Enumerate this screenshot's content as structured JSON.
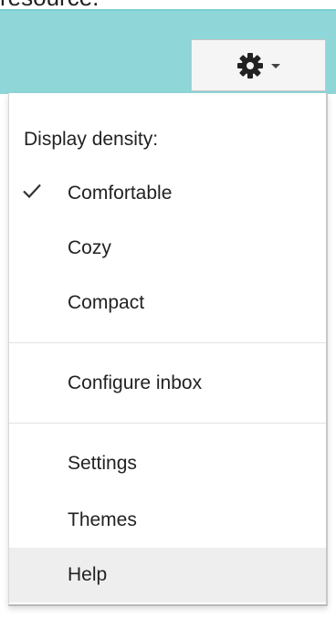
{
  "background_partial_text": "resource.",
  "header": {
    "settings_button": {
      "icon": "gear-icon",
      "dropdown_icon": "caret-down-icon"
    }
  },
  "menu": {
    "heading": "Display density:",
    "density_options": [
      {
        "label": "Comfortable",
        "checked": true
      },
      {
        "label": "Cozy",
        "checked": false
      },
      {
        "label": "Compact",
        "checked": false
      }
    ],
    "configure_inbox": "Configure inbox",
    "settings": "Settings",
    "themes": "Themes",
    "help": "Help",
    "hovered_item": "Help"
  },
  "colors": {
    "header_band": "#8fd6d8",
    "hover_row": "#eeeeee",
    "text": "#222222"
  }
}
